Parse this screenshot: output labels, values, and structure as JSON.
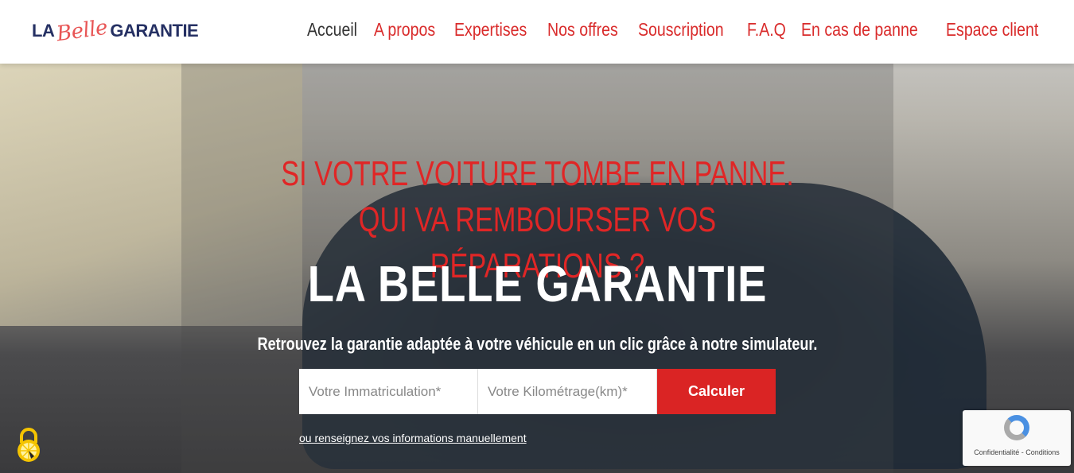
{
  "header": {
    "logo": {
      "left": "LA",
      "script": "Belle",
      "right": "GARANTIE"
    },
    "nav": [
      {
        "label": "Accueil",
        "active": true
      },
      {
        "label": "A propos"
      },
      {
        "label": "Expertises"
      },
      {
        "label": "Nos offres"
      },
      {
        "label": "Souscription"
      },
      {
        "label": "F.A.Q"
      },
      {
        "label": "En cas de panne"
      },
      {
        "label": "Espace client"
      }
    ]
  },
  "hero": {
    "question": "Si votre voiture tombe en panne. Qui va rembourser vos réparations ?",
    "title": "LA BELLE GARANTIE",
    "subtitle": "Retrouvez la garantie adaptée à votre véhicule en un clic grâce à notre simulateur.",
    "form": {
      "plate_placeholder": "Votre Immatriculation*",
      "km_placeholder": "Votre Kilométrage(km)*",
      "submit": "Calculer"
    },
    "manual_link": "ou renseignez vos informations manuellement"
  },
  "recaptcha": {
    "text": "Confidentialité - Conditions"
  },
  "colors": {
    "accent": "#da2424",
    "brand_navy": "#253063"
  }
}
